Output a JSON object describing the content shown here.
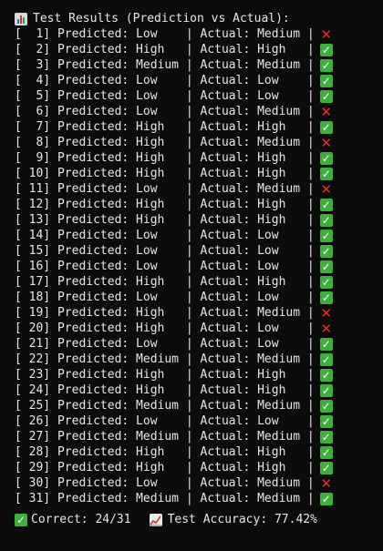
{
  "header": {
    "title": "Test Results (Prediction vs Actual):",
    "icon": "bar-chart-icon"
  },
  "rows": [
    {
      "text": "[  1] Predicted: Low    | Actual: Medium |",
      "correct": false
    },
    {
      "text": "[  2] Predicted: High   | Actual: High   |",
      "correct": true
    },
    {
      "text": "[  3] Predicted: Medium | Actual: Medium |",
      "correct": true
    },
    {
      "text": "[  4] Predicted: Low    | Actual: Low    |",
      "correct": true
    },
    {
      "text": "[  5] Predicted: Low    | Actual: Low    |",
      "correct": true
    },
    {
      "text": "[  6] Predicted: Low    | Actual: Medium |",
      "correct": false
    },
    {
      "text": "[  7] Predicted: High   | Actual: High   |",
      "correct": true
    },
    {
      "text": "[  8] Predicted: High   | Actual: Medium |",
      "correct": false
    },
    {
      "text": "[  9] Predicted: High   | Actual: High   |",
      "correct": true
    },
    {
      "text": "[ 10] Predicted: High   | Actual: High   |",
      "correct": true
    },
    {
      "text": "[ 11] Predicted: Low    | Actual: Medium |",
      "correct": false
    },
    {
      "text": "[ 12] Predicted: High   | Actual: High   |",
      "correct": true
    },
    {
      "text": "[ 13] Predicted: High   | Actual: High   |",
      "correct": true
    },
    {
      "text": "[ 14] Predicted: Low    | Actual: Low    |",
      "correct": true
    },
    {
      "text": "[ 15] Predicted: Low    | Actual: Low    |",
      "correct": true
    },
    {
      "text": "[ 16] Predicted: Low    | Actual: Low    |",
      "correct": true
    },
    {
      "text": "[ 17] Predicted: High   | Actual: High   |",
      "correct": true
    },
    {
      "text": "[ 18] Predicted: Low    | Actual: Low    |",
      "correct": true
    },
    {
      "text": "[ 19] Predicted: High   | Actual: Medium |",
      "correct": false
    },
    {
      "text": "[ 20] Predicted: High   | Actual: Low    |",
      "correct": false
    },
    {
      "text": "[ 21] Predicted: Low    | Actual: Low    |",
      "correct": true
    },
    {
      "text": "[ 22] Predicted: Medium | Actual: Medium |",
      "correct": true
    },
    {
      "text": "[ 23] Predicted: High   | Actual: High   |",
      "correct": true
    },
    {
      "text": "[ 24] Predicted: High   | Actual: High   |",
      "correct": true
    },
    {
      "text": "[ 25] Predicted: Medium | Actual: Medium |",
      "correct": true
    },
    {
      "text": "[ 26] Predicted: Low    | Actual: Low    |",
      "correct": true
    },
    {
      "text": "[ 27] Predicted: Medium | Actual: Medium |",
      "correct": true
    },
    {
      "text": "[ 28] Predicted: High   | Actual: High   |",
      "correct": true
    },
    {
      "text": "[ 29] Predicted: High   | Actual: High   |",
      "correct": true
    },
    {
      "text": "[ 30] Predicted: Low    | Actual: Medium |",
      "correct": false
    },
    {
      "text": "[ 31] Predicted: Medium | Actual: Medium |",
      "correct": true
    }
  ],
  "marks": {
    "correct_glyph": "✓",
    "wrong_glyph": "✕",
    "correct_color": "#3fae3a",
    "wrong_color": "#e0322c"
  },
  "summary": {
    "correct_text": "Correct: 24/31",
    "accuracy_text": "Test Accuracy: 77.42%",
    "correct_icon": "check-box-icon",
    "accuracy_icon": "trend-chart-icon"
  },
  "colors": {
    "background": "#0c0c0c",
    "text": "#e6e6e6"
  }
}
